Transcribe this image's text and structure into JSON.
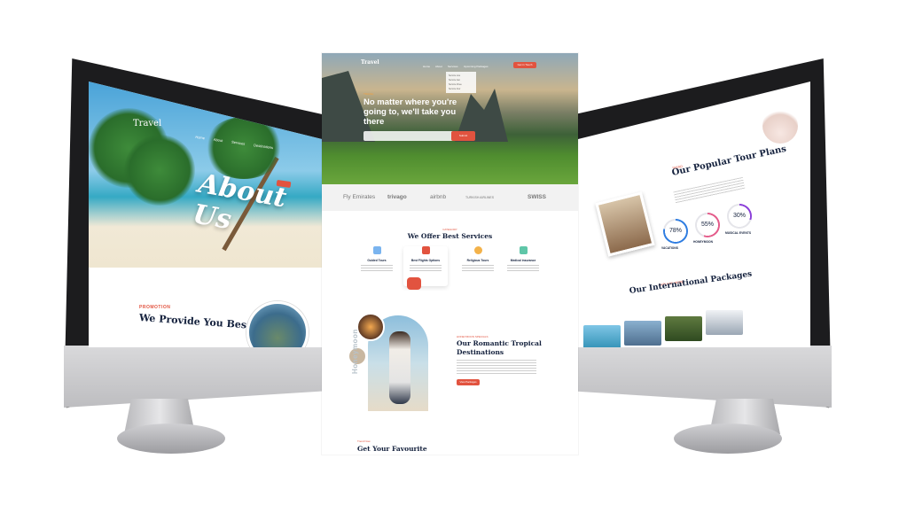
{
  "left_screen": {
    "logo": "Travel",
    "nav": [
      "Home",
      "About",
      "Services",
      "Destinations",
      "Contact"
    ],
    "hero_title": "About Us",
    "promo_tag": "PROMOTION",
    "heading": "We Provide You Best"
  },
  "center_page": {
    "logo": "Travel",
    "nav": [
      "Home",
      "About",
      "Services",
      "Upcoming Packages"
    ],
    "cta": "Get in Touch",
    "dropdown": [
      "Service one",
      "Service two",
      "Service three",
      "Service four"
    ],
    "hero_tag": "TRAVEL",
    "hero_title": "No matter where you're going to, we'll take you there",
    "search_button": "Submit",
    "brands": [
      "Fly Emirates",
      "trivago",
      "airbnb",
      "TURKISH AIRLINES",
      "SWISS"
    ],
    "services_tag": "CATEGORY",
    "services_title": "We Offer Best Services",
    "services": [
      "Guided Tours",
      "Best Flights Options",
      "Religious Tours",
      "Medical insurance"
    ],
    "honeymoon_vertical": "Honeymoon",
    "honeymoon_tag": "HONEYMOON SPECIALS",
    "honeymoon_title": "Our Romantic Tropical Destinations",
    "honeymoon_button": "View Packages",
    "fav_tag": "Trend Now",
    "fav_title": "Get Your Favourite"
  },
  "right_screen": {
    "tour_tag": "TREND",
    "tour_title": "Our Popular Tour Plans",
    "stats": [
      {
        "label": "VACATIONS",
        "value": "78%",
        "percent": 78,
        "color": "#2f7de1"
      },
      {
        "label": "HONEYMOON",
        "value": "55%",
        "percent": 55,
        "color": "#e45b8a"
      },
      {
        "label": "MUSICAL EVENTS",
        "value": "30%",
        "percent": 30,
        "color": "#8b3fd9"
      }
    ],
    "packages_tag": "EXPLORE MORE",
    "packages_title": "Our International Packages"
  },
  "colors": {
    "accent": "#e2533f",
    "navy": "#14213d"
  }
}
